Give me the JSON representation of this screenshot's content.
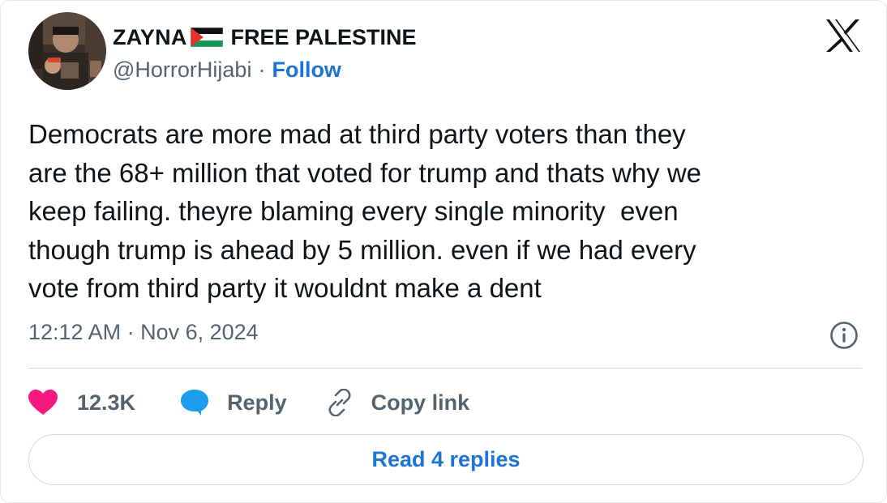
{
  "author": {
    "name": "ZAYNA",
    "name_suffix": "FREE PALESTINE",
    "flag_icon": "palestine-flag-icon",
    "handle": "@HorrorHijabi",
    "separator": "·",
    "follow_label": "Follow"
  },
  "tweet": {
    "text": "Democrats are more mad at third party voters than they\nare the 68+ million that voted for trump and thats why we\nkeep failing. theyre blaming every single minority  even\nthough trump is ahead by 5 million. even if we had every\nvote from third party it wouldnt make a dent",
    "timestamp": "12:12 AM · Nov 6, 2024"
  },
  "actions": {
    "likes_count": "12.3K",
    "reply_label": "Reply",
    "copy_link_label": "Copy link"
  },
  "footer": {
    "read_replies_label": "Read 4 replies"
  },
  "icons": {
    "close": "x-logo-icon",
    "info": "info-icon",
    "like": "heart-icon",
    "reply": "speech-bubble-icon",
    "copy": "link-icon"
  },
  "colors": {
    "accent": "#1d74d6",
    "like": "#f91880",
    "reply": "#1d9bf0",
    "muted": "#536471",
    "text": "#0f1419",
    "border": "#cfd9de"
  }
}
